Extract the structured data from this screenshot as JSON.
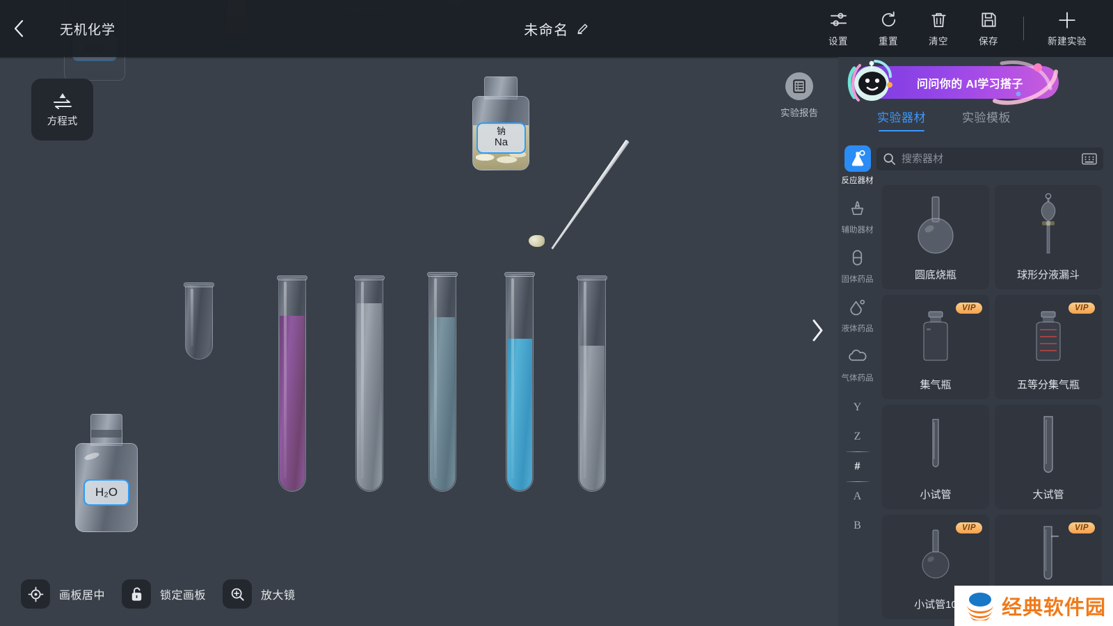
{
  "header": {
    "back_icon": "chevron-left-icon",
    "project_name": "无机化学",
    "doc_title": "未命名",
    "edit_icon": "pencil-icon",
    "tools": [
      {
        "label": "设置",
        "icon": "sliders-icon"
      },
      {
        "label": "重置",
        "icon": "refresh-icon"
      },
      {
        "label": "清空",
        "icon": "trash-icon"
      },
      {
        "label": "保存",
        "icon": "save-floppy-icon"
      },
      {
        "label": "新建实验",
        "icon": "plus-icon"
      }
    ]
  },
  "left_tools": {
    "equation": {
      "label": "方程式",
      "icon": "reaction-arrows-icon"
    }
  },
  "bottom_bar": [
    {
      "label": "画板居中",
      "icon": "crosshair-icon"
    },
    {
      "label": "锁定画板",
      "icon": "unlock-icon"
    },
    {
      "label": "放大镜",
      "icon": "magnifier-plus-icon"
    }
  ],
  "report_button": {
    "label": "实验报告",
    "icon": "report-list-icon"
  },
  "panel": {
    "collapse_icon": "chevron-right-icon",
    "ai_banner": {
      "text": "问问你的 AI学习搭子",
      "icon": "ai-robot-icon"
    },
    "tabs": [
      {
        "label": "实验器材",
        "active": true
      },
      {
        "label": "实验模板",
        "active": false
      }
    ],
    "search": {
      "placeholder": "搜索器材",
      "value": "",
      "icon": "search-icon",
      "keyboard_icon": "keyboard-icon"
    },
    "rail": {
      "categories": [
        {
          "label": "反应器材",
          "icon": "flask-icon",
          "active": true
        },
        {
          "label": "辅助器材",
          "icon": "alcohol-lamp-icon",
          "active": false
        },
        {
          "label": "固体药品",
          "icon": "capsule-icon",
          "active": false
        },
        {
          "label": "液体药品",
          "icon": "droplet-icon",
          "active": false
        },
        {
          "label": "气体药品",
          "icon": "cloud-icon",
          "active": false
        }
      ],
      "letters": [
        {
          "ch": "Y",
          "current": false
        },
        {
          "ch": "Z",
          "current": false
        },
        {
          "ch": "#",
          "current": true
        },
        {
          "ch": "A",
          "current": false
        },
        {
          "ch": "B",
          "current": false
        }
      ]
    },
    "items": [
      {
        "name": "圆底烧瓶",
        "vip": false,
        "art": "round-bottom-flask"
      },
      {
        "name": "球形分液漏斗",
        "vip": false,
        "art": "separating-funnel"
      },
      {
        "name": "集气瓶",
        "vip": true,
        "art": "gas-jar"
      },
      {
        "name": "五等分集气瓶",
        "vip": true,
        "art": "graduated-gas-jar"
      },
      {
        "name": "小试管",
        "vip": false,
        "art": "small-test-tube"
      },
      {
        "name": "大试管",
        "vip": false,
        "art": "large-test-tube"
      },
      {
        "name": "小试管10",
        "vip": true,
        "art": "small-flask"
      },
      {
        "name": "",
        "vip": true,
        "art": "tube-with-arm"
      }
    ]
  },
  "scene": {
    "bottles": [
      {
        "id": "sodium-bottle",
        "label_line1": "钠",
        "label_line2": "Na"
      },
      {
        "id": "water-bottle",
        "label_line1": "H₂O",
        "label_line2": ""
      }
    ],
    "tubes": [
      {
        "id": "tube-1",
        "liquid": "none",
        "fill_percent": 0,
        "color": ""
      },
      {
        "id": "tube-2",
        "liquid": "purple",
        "fill_percent": 82,
        "color": "#7a4a86"
      },
      {
        "id": "tube-3",
        "liquid": "clear-gray",
        "fill_percent": 88,
        "color": "#8d949c"
      },
      {
        "id": "tube-4",
        "liquid": "blue-gray",
        "fill_percent": 80,
        "color": "#6d838f"
      },
      {
        "id": "tube-5",
        "liquid": "cyan-blue",
        "fill_percent": 70,
        "color": "#3e9fc9"
      },
      {
        "id": "tube-6",
        "liquid": "gray",
        "fill_percent": 68,
        "color": "#8b9198"
      }
    ],
    "tool": {
      "id": "tweezers",
      "name": "镊子"
    }
  },
  "watermark": {
    "text": "经典软件园",
    "logo": "stacked-bowl-logo"
  },
  "colors": {
    "accent_blue": "#2a8cf5",
    "tab_active": "#3a97ff",
    "panel_bg": "#353b44",
    "card_bg": "#30353e",
    "canvas_bg": "#3a4049",
    "header_bg": "#1b1f26",
    "vip_gold": "#f4a14e",
    "watermark_orange": "#f07a1a"
  }
}
